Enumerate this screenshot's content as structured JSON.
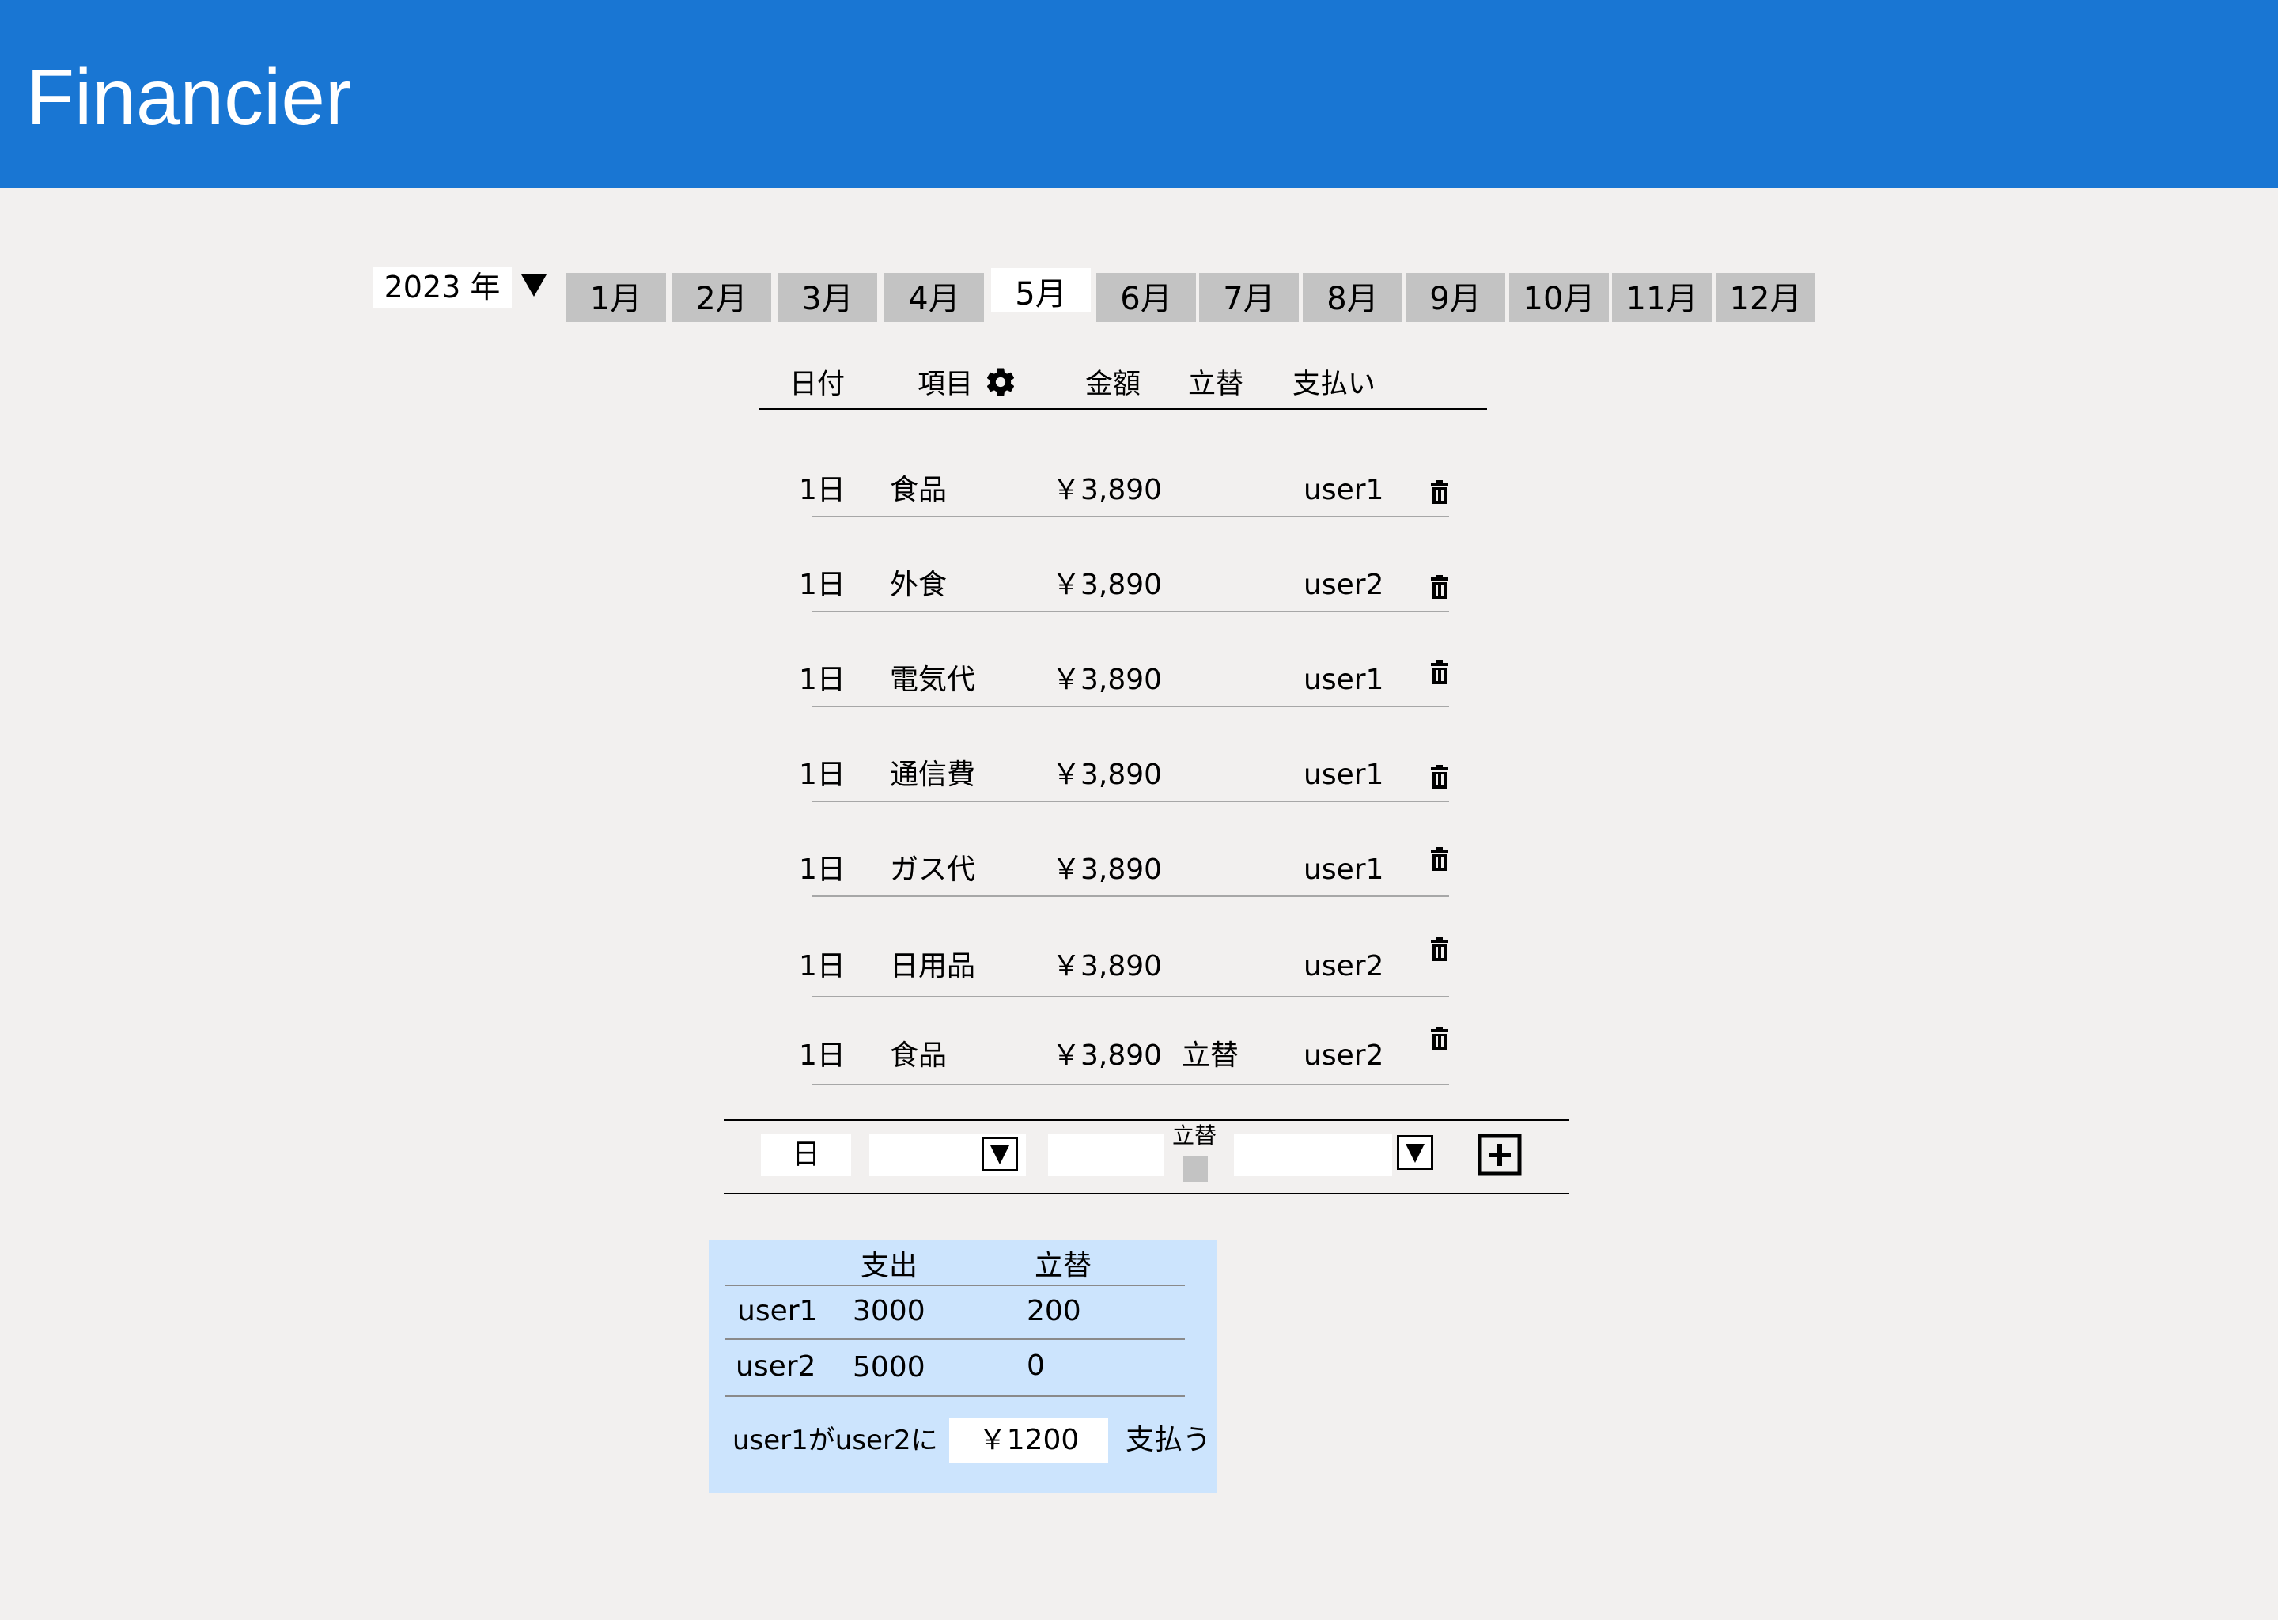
{
  "app": {
    "title": "Financier"
  },
  "year_selector": {
    "value": "2023 年"
  },
  "months": [
    "1月",
    "2月",
    "3月",
    "4月",
    "5月",
    "6月",
    "7月",
    "8月",
    "9月",
    "10月",
    "11月",
    "12月"
  ],
  "active_month": "5月",
  "columns": {
    "date": "日付",
    "item": "項目",
    "amount": "金額",
    "tatekae": "立替",
    "payer": "支払い"
  },
  "rows": [
    {
      "date": "1日",
      "item": "食品",
      "amount": "￥3,890",
      "tatekae": "",
      "payer": "user1"
    },
    {
      "date": "1日",
      "item": "外食",
      "amount": "￥3,890",
      "tatekae": "",
      "payer": "user2"
    },
    {
      "date": "1日",
      "item": "電気代",
      "amount": "￥3,890",
      "tatekae": "",
      "payer": "user1"
    },
    {
      "date": "1日",
      "item": "通信費",
      "amount": "￥3,890",
      "tatekae": "",
      "payer": "user1"
    },
    {
      "date": "1日",
      "item": "ガス代",
      "amount": "￥3,890",
      "tatekae": "",
      "payer": "user1"
    },
    {
      "date": "1日",
      "item": "日用品",
      "amount": "￥3,890",
      "tatekae": "",
      "payer": "user2"
    },
    {
      "date": "1日",
      "item": "食品",
      "amount": "￥3,890",
      "tatekae": "立替",
      "payer": "user2"
    }
  ],
  "add_form": {
    "day_label": "日",
    "tatekae_label": "立替"
  },
  "summary": {
    "headers": {
      "expense": "支出",
      "tatekae": "立替"
    },
    "users": [
      {
        "name": "user1",
        "expense": "3000",
        "tatekae": "200"
      },
      {
        "name": "user2",
        "expense": "5000",
        "tatekae": "0"
      }
    ],
    "settlement": {
      "prefix": "user1がuser2に",
      "amount": "￥1200",
      "suffix": "支払う"
    }
  },
  "colors": {
    "header": "#1976d3",
    "tab": "#c3c3c3",
    "summary_bg": "#cce4fd",
    "page_bg": "#f2f0ef"
  }
}
